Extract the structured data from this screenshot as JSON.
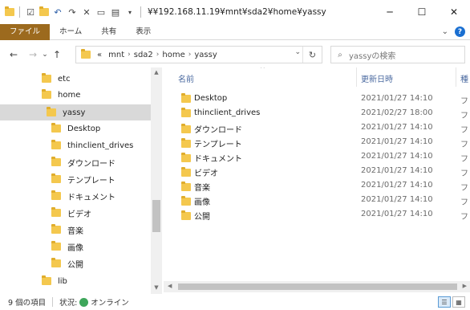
{
  "window": {
    "title": "¥¥192.168.11.19¥mnt¥sda2¥home¥yassy",
    "minimize": "─",
    "maximize": "☐",
    "close": "✕"
  },
  "ribbon": {
    "tabs": [
      "ファイル",
      "ホーム",
      "共有",
      "表示"
    ],
    "expand": "⌄",
    "help": "?"
  },
  "address": {
    "back": "←",
    "forward": "→",
    "recent": "⌄",
    "up": "↑",
    "overflow": "«",
    "crumbs": [
      "mnt",
      "sda2",
      "home",
      "yassy"
    ],
    "sep": "›",
    "dropdown": "⌄",
    "refresh": "↻"
  },
  "search": {
    "placeholder": "yassyの検索",
    "icon": "⌕"
  },
  "nav": {
    "items": [
      {
        "label": "etc"
      },
      {
        "label": "home"
      },
      {
        "label": "yassy"
      },
      {
        "label": "Desktop"
      },
      {
        "label": "thinclient_drives"
      },
      {
        "label": "ダウンロード"
      },
      {
        "label": "テンプレート"
      },
      {
        "label": "ドキュメント"
      },
      {
        "label": "ビデオ"
      },
      {
        "label": "音楽"
      },
      {
        "label": "画像"
      },
      {
        "label": "公開"
      },
      {
        "label": "lib"
      }
    ]
  },
  "columns": {
    "name": "名前",
    "date": "更新日時",
    "type": "種",
    "sort": "^"
  },
  "files": [
    {
      "name": "Desktop",
      "date": "2021/01/27 14:10",
      "type": "フ"
    },
    {
      "name": "thinclient_drives",
      "date": "2021/02/27 18:00",
      "type": "フ"
    },
    {
      "name": "ダウンロード",
      "date": "2021/01/27 14:10",
      "type": "フ"
    },
    {
      "name": "テンプレート",
      "date": "2021/01/27 14:10",
      "type": "フ"
    },
    {
      "name": "ドキュメント",
      "date": "2021/01/27 14:10",
      "type": "フ"
    },
    {
      "name": "ビデオ",
      "date": "2021/01/27 14:10",
      "type": "フ"
    },
    {
      "name": "音楽",
      "date": "2021/01/27 14:10",
      "type": "フ"
    },
    {
      "name": "画像",
      "date": "2021/01/27 14:10",
      "type": "フ"
    },
    {
      "name": "公開",
      "date": "2021/01/27 14:10",
      "type": "フ"
    }
  ],
  "status": {
    "count": "9 個の項目",
    "state_label": "状況:",
    "state_value": "オンライン"
  },
  "colors": {
    "file_tab": "#9c6a1e",
    "folder": "#f4c84e",
    "header_text": "#4b6aa0"
  }
}
